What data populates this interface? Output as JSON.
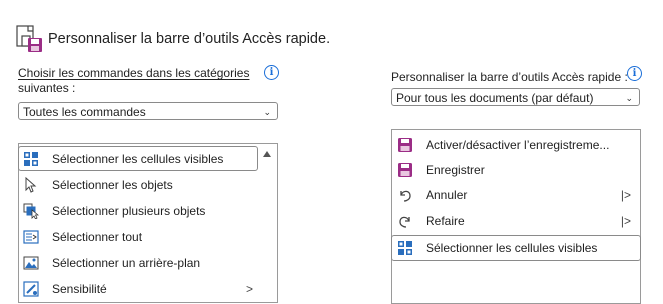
{
  "dialog": {
    "title": "Personnaliser la barre d’outils Accès rapide."
  },
  "left": {
    "label_line1": "Choisir les commandes dans les catégories",
    "label_line2": "suivantes :",
    "dropdown_value": "Toutes les commandes",
    "items": [
      {
        "label": "Sélectionner les cellules visibles",
        "icon": "visible-cells-icon",
        "selected": true
      },
      {
        "label": "Sélectionner les objets",
        "icon": "pointer-arrow-icon"
      },
      {
        "label": "Sélectionner plusieurs objets",
        "icon": "multiple-objects-icon"
      },
      {
        "label": "Sélectionner tout",
        "icon": "select-all-icon"
      },
      {
        "label": "Sélectionner un arrière-plan",
        "icon": "background-image-icon"
      },
      {
        "label": "Sensibilité",
        "icon": "sensitivity-icon",
        "submenu": ">"
      }
    ]
  },
  "right": {
    "label": "Personnaliser la barre d’outils Accès rapide :",
    "dropdown_value": "Pour tous les documents (par défaut)",
    "items": [
      {
        "label": "Activer/désactiver l’enregistreme...",
        "icon": "autosave-icon"
      },
      {
        "label": "Enregistrer",
        "icon": "save-icon"
      },
      {
        "label": "Annuler",
        "icon": "undo-icon",
        "submenu": "|>"
      },
      {
        "label": "Refaire",
        "icon": "redo-icon",
        "submenu": "|>"
      },
      {
        "label": "Sélectionner les cellules visibles",
        "icon": "visible-cells-icon",
        "selected": true
      }
    ]
  },
  "colors": {
    "accent": "#1a6ed8",
    "save_purple": "#9b2d86",
    "grid_blue": "#2a6ebd"
  }
}
